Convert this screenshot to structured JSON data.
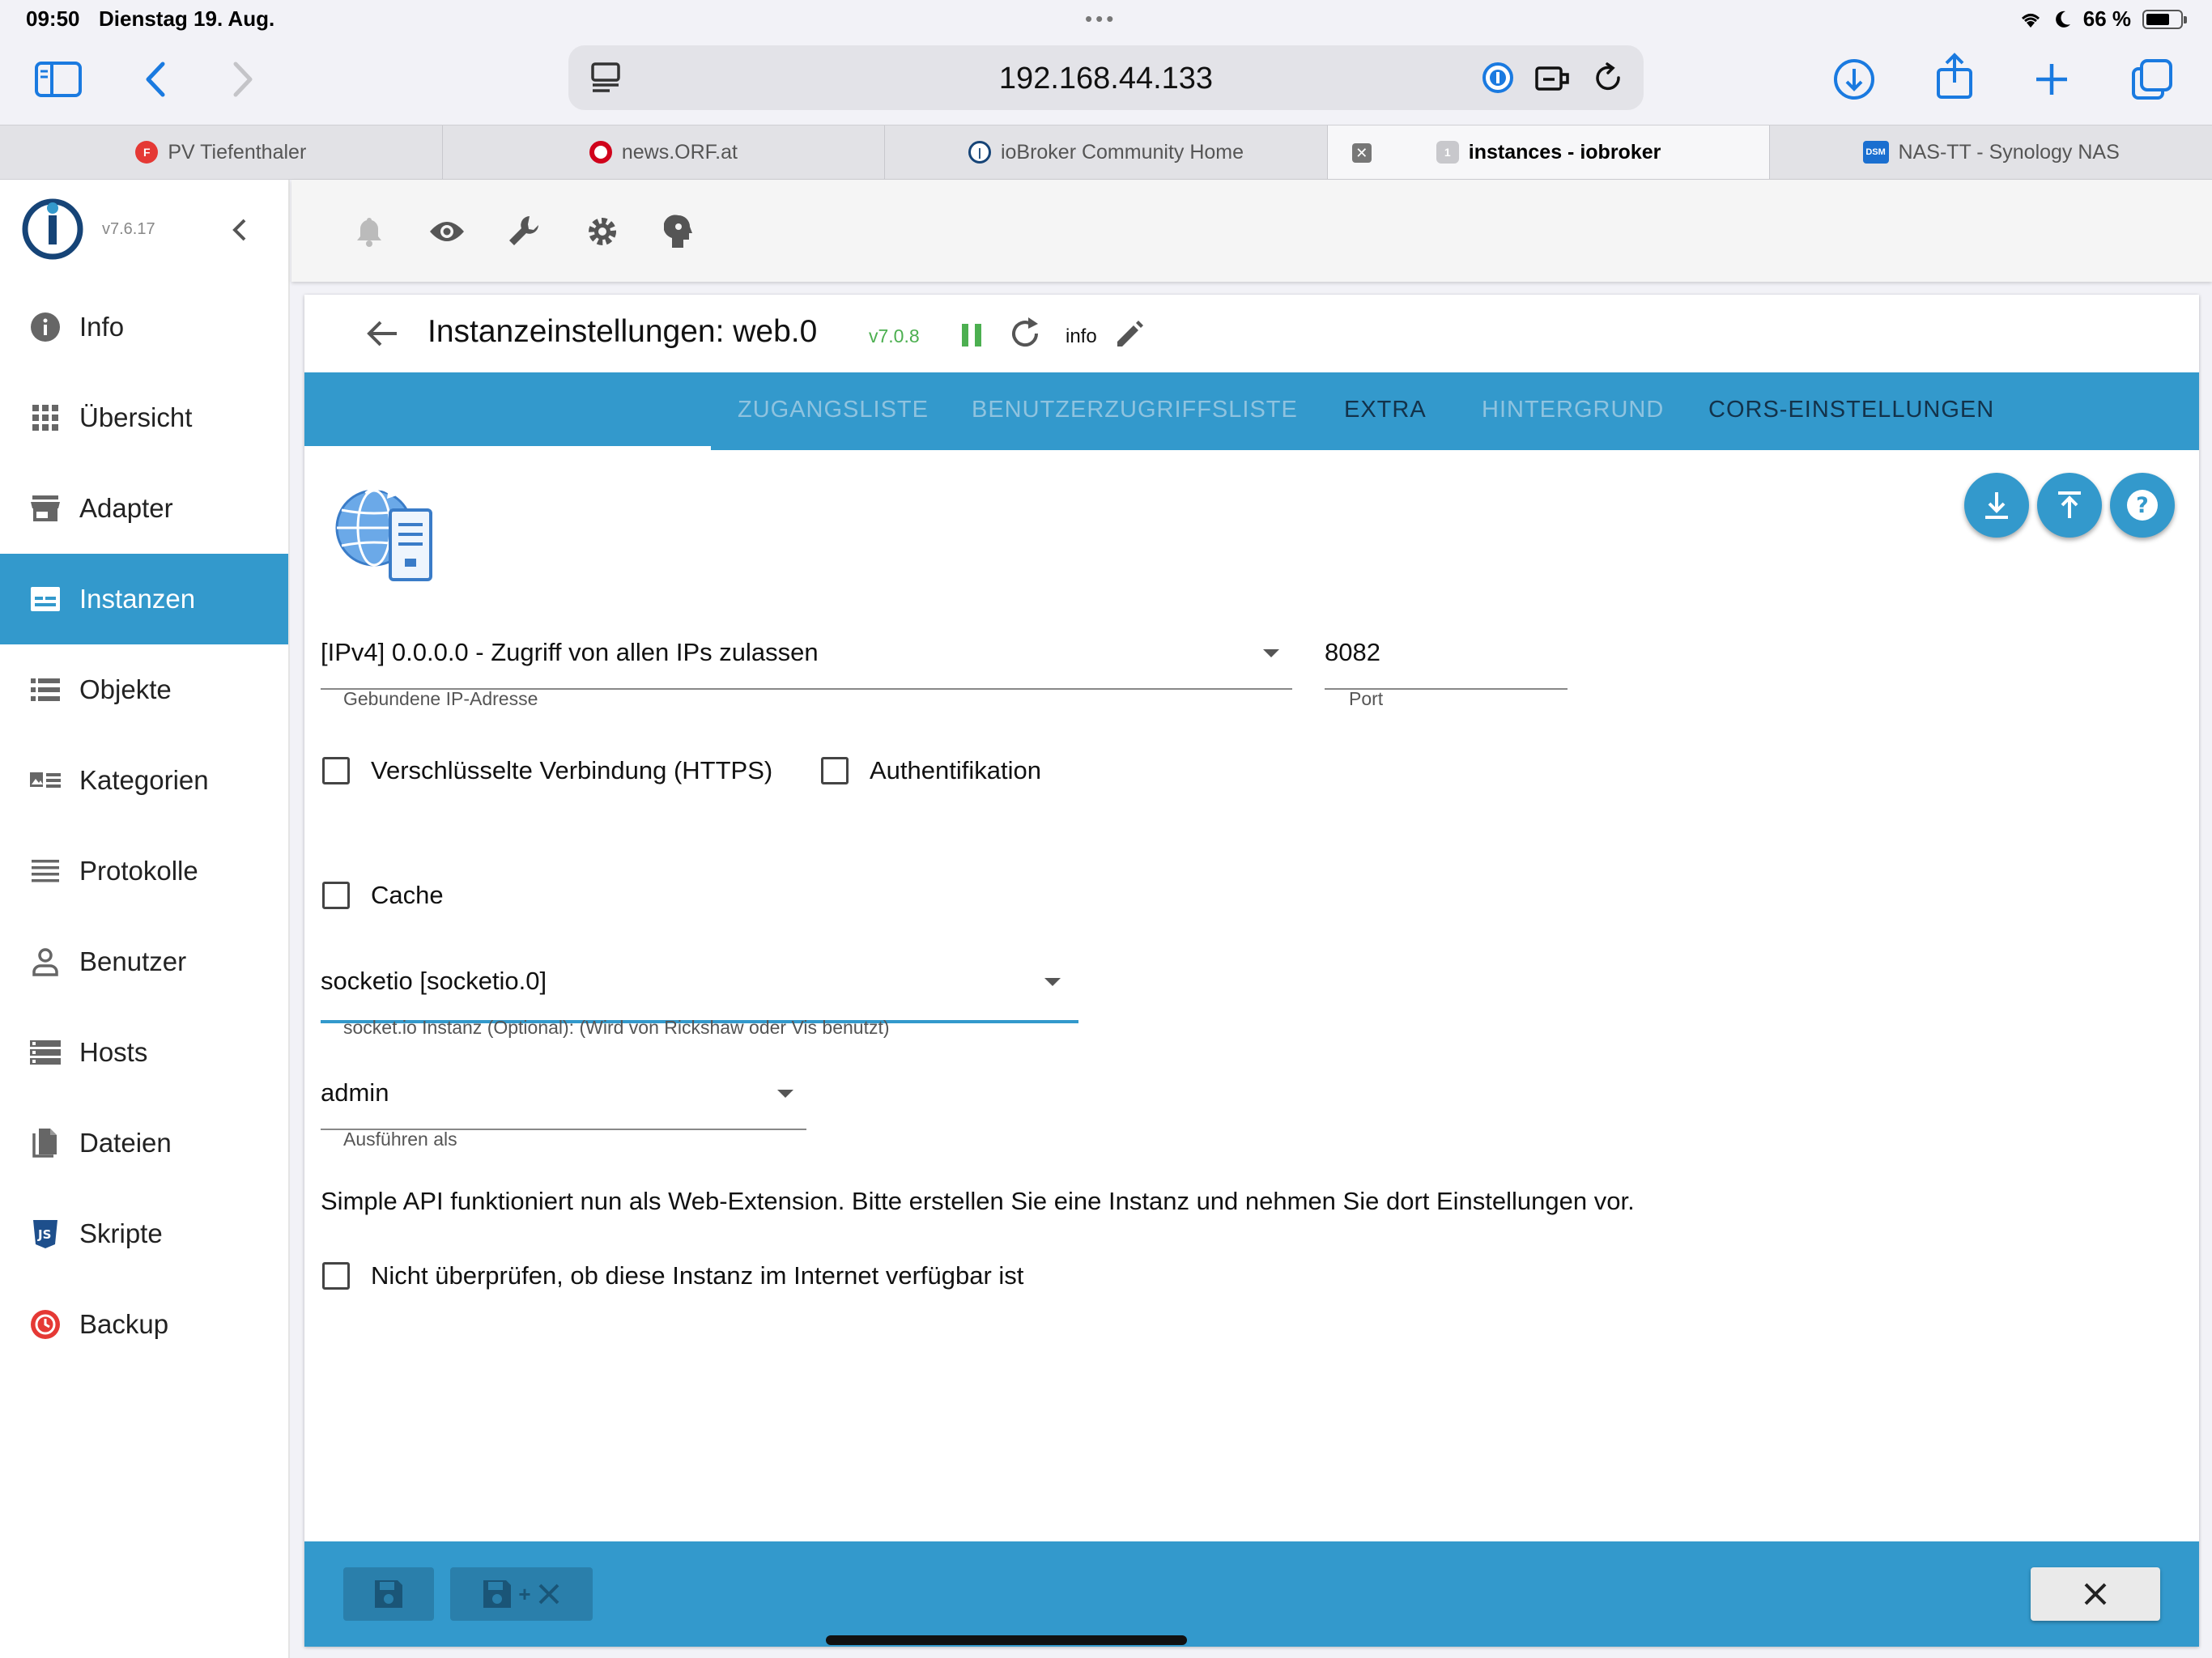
{
  "status": {
    "time": "09:50",
    "date": "Dienstag 19. Aug.",
    "battery": "66 %"
  },
  "browser": {
    "url": "192.168.44.133",
    "tabs": [
      {
        "label": "PV Tiefenthaler"
      },
      {
        "label": "news.ORF.at"
      },
      {
        "label": "ioBroker Community Home"
      },
      {
        "label": "instances - iobroker",
        "badge": "1"
      },
      {
        "label": "NAS-TT - Synology NAS",
        "badge": "DSM"
      }
    ]
  },
  "app": {
    "version": "v7.6.17",
    "nav": [
      {
        "label": "Info",
        "icon": "info-icon"
      },
      {
        "label": "Übersicht",
        "icon": "grid-icon"
      },
      {
        "label": "Adapter",
        "icon": "store-icon"
      },
      {
        "label": "Instanzen",
        "icon": "instances-icon"
      },
      {
        "label": "Objekte",
        "icon": "list-icon"
      },
      {
        "label": "Kategorien",
        "icon": "categories-icon"
      },
      {
        "label": "Protokolle",
        "icon": "log-icon"
      },
      {
        "label": "Benutzer",
        "icon": "user-icon"
      },
      {
        "label": "Hosts",
        "icon": "hosts-icon"
      },
      {
        "label": "Dateien",
        "icon": "files-icon"
      },
      {
        "label": "Skripte",
        "icon": "js-icon"
      },
      {
        "label": "Backup",
        "icon": "backup-icon"
      }
    ],
    "active_nav": "Instanzen"
  },
  "settings": {
    "title": "Instanzeinstellungen: web.0",
    "version": "v7.0.8",
    "info_label": "info",
    "tabs": [
      {
        "label": "ZUGANGSLISTE"
      },
      {
        "label": "BENUTZERZUGRIFFSLISTE"
      },
      {
        "label": "EXTRA"
      },
      {
        "label": "HINTERGRUND"
      },
      {
        "label": "CORS-EINSTELLUNGEN"
      }
    ],
    "bind": {
      "value": "[IPv4] 0.0.0.0 - Zugriff von allen IPs zulassen",
      "label": "Gebundene IP-Adresse"
    },
    "port": {
      "value": "8082",
      "label": "Port"
    },
    "https_label": "Verschlüsselte Verbindung (HTTPS)",
    "auth_label": "Authentifikation",
    "cache_label": "Cache",
    "socketio": {
      "value": "socketio [socketio.0]",
      "label": "socket.io Instanz (Optional): (Wird von Rickshaw oder Vis benutzt)"
    },
    "run_as": {
      "value": "admin",
      "label": "Ausführen als"
    },
    "note": "Simple API funktioniert nun als Web-Extension. Bitte erstellen Sie eine Instanz und nehmen Sie dort Einstellungen vor.",
    "no_check_label": "Nicht überprüfen, ob diese Instanz im Internet verfügbar ist",
    "colors": {
      "primary": "#3399cc",
      "running": "#4caf50"
    }
  }
}
